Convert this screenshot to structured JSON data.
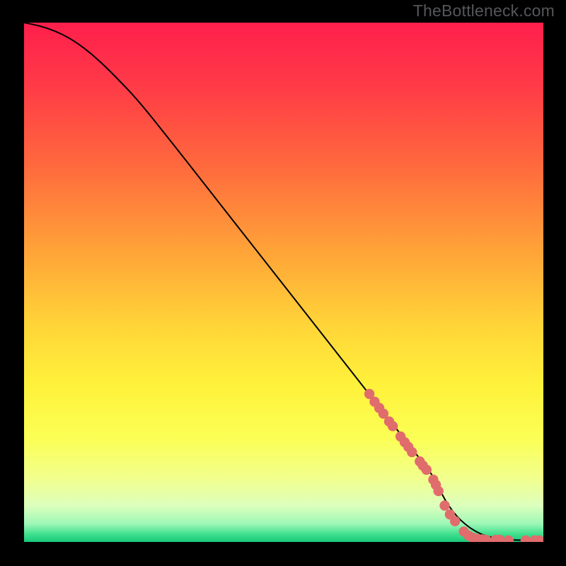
{
  "attribution": "TheBottleneck.com",
  "colors": {
    "background": "#000000",
    "attribution_text": "#555659",
    "curve_stroke": "#000000",
    "marker_fill": "#e06c6c",
    "marker_stroke": "#d35b5b"
  },
  "chart_data": {
    "type": "line",
    "title": "",
    "xlabel": "",
    "ylabel": "",
    "xlim": [
      0,
      100
    ],
    "ylim": [
      0,
      100
    ],
    "gradient_stops": [
      {
        "offset": 0.0,
        "color": "#ff1f4c"
      },
      {
        "offset": 0.12,
        "color": "#ff3a47"
      },
      {
        "offset": 0.28,
        "color": "#ff6b3d"
      },
      {
        "offset": 0.44,
        "color": "#ffa338"
      },
      {
        "offset": 0.58,
        "color": "#ffd438"
      },
      {
        "offset": 0.7,
        "color": "#fff23b"
      },
      {
        "offset": 0.8,
        "color": "#fbff55"
      },
      {
        "offset": 0.88,
        "color": "#f1ff8f"
      },
      {
        "offset": 0.93,
        "color": "#dcffbd"
      },
      {
        "offset": 0.965,
        "color": "#9ef7b6"
      },
      {
        "offset": 0.985,
        "color": "#3fe08e"
      },
      {
        "offset": 1.0,
        "color": "#17c97a"
      }
    ],
    "series": [
      {
        "name": "bottleneck-curve",
        "x": [
          0,
          3,
          6,
          9,
          12,
          15,
          18,
          22,
          28,
          35,
          45,
          55,
          65,
          72,
          76,
          78,
          79.5,
          81,
          84,
          88,
          92,
          96,
          100
        ],
        "y": [
          100,
          99.4,
          98.4,
          96.9,
          94.8,
          92.2,
          89.2,
          85,
          77.5,
          68.6,
          55.8,
          43.1,
          30.3,
          21.4,
          16.3,
          13.7,
          11.5,
          8.0,
          4.0,
          1.3,
          0.5,
          0.3,
          0.3
        ]
      }
    ],
    "markers": [
      {
        "x": 66.5,
        "y": 28.5
      },
      {
        "x": 67.5,
        "y": 27.0
      },
      {
        "x": 68.4,
        "y": 25.8
      },
      {
        "x": 69.2,
        "y": 24.7
      },
      {
        "x": 70.3,
        "y": 23.2
      },
      {
        "x": 71.0,
        "y": 22.3
      },
      {
        "x": 72.5,
        "y": 20.3
      },
      {
        "x": 73.3,
        "y": 19.2
      },
      {
        "x": 74.0,
        "y": 18.3
      },
      {
        "x": 74.7,
        "y": 17.3
      },
      {
        "x": 76.2,
        "y": 15.5
      },
      {
        "x": 76.8,
        "y": 14.7
      },
      {
        "x": 77.5,
        "y": 13.9
      },
      {
        "x": 78.8,
        "y": 12.0
      },
      {
        "x": 79.3,
        "y": 11.0
      },
      {
        "x": 79.8,
        "y": 9.8
      },
      {
        "x": 81.0,
        "y": 7.0
      },
      {
        "x": 82.0,
        "y": 5.3
      },
      {
        "x": 83.0,
        "y": 4.0
      },
      {
        "x": 84.7,
        "y": 2.0
      },
      {
        "x": 85.6,
        "y": 1.2
      },
      {
        "x": 86.4,
        "y": 0.8
      },
      {
        "x": 87.3,
        "y": 0.6
      },
      {
        "x": 88.2,
        "y": 0.5
      },
      {
        "x": 89.0,
        "y": 0.4
      },
      {
        "x": 90.8,
        "y": 0.4
      },
      {
        "x": 91.6,
        "y": 0.4
      },
      {
        "x": 93.3,
        "y": 0.3
      },
      {
        "x": 96.6,
        "y": 0.3
      },
      {
        "x": 98.3,
        "y": 0.3
      },
      {
        "x": 99.2,
        "y": 0.3
      }
    ]
  }
}
